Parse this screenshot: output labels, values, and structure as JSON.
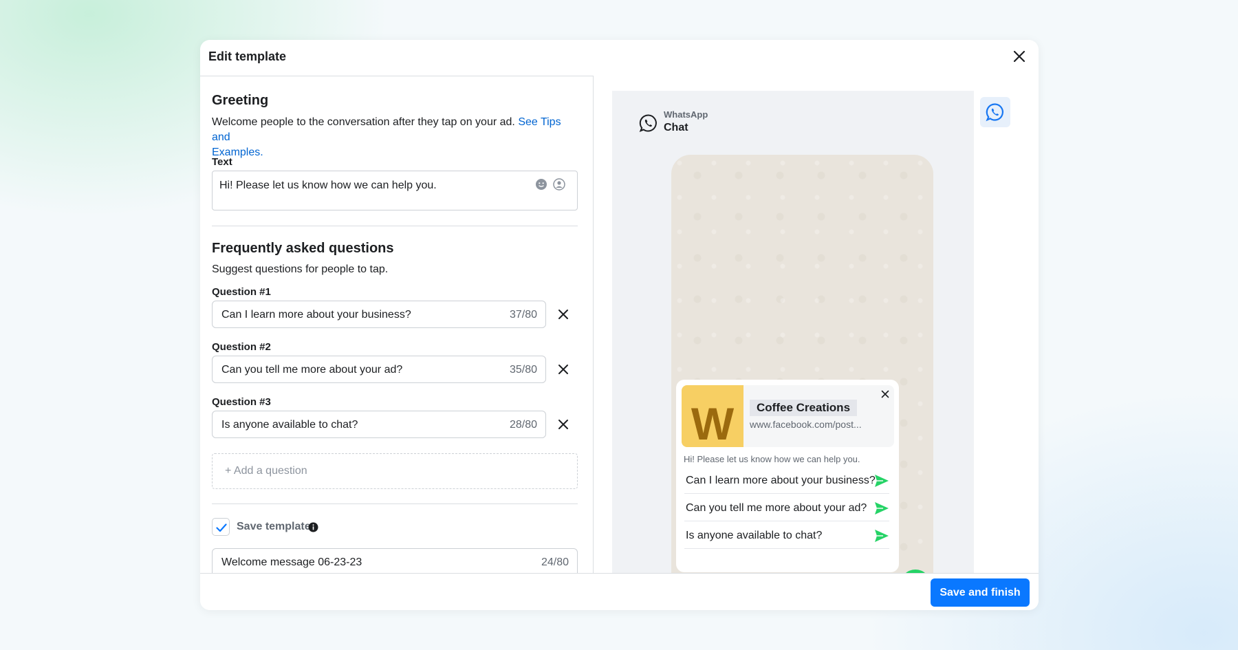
{
  "modal": {
    "title": "Edit template"
  },
  "greeting": {
    "title": "Greeting",
    "description": "Welcome people to the conversation after they tap on your ad.",
    "link_line1": "See Tips and",
    "link_line2": "Examples.",
    "text_label": "Text",
    "text_value": "Hi! Please let us know how we can help you."
  },
  "faq": {
    "title": "Frequently asked questions",
    "description": "Suggest questions for people to tap.",
    "questions": [
      {
        "label": "Question #1",
        "value": "Can I learn more about your business?",
        "count": "37/80"
      },
      {
        "label": "Question #2",
        "value": "Can you tell me more about your ad?",
        "count": "35/80"
      },
      {
        "label": "Question #3",
        "value": "Is anyone available to chat?",
        "count": "28/80"
      }
    ],
    "add_label": "+ Add a question"
  },
  "save_template": {
    "checked": true,
    "label": "Save template",
    "name_value": "Welcome message 06-23-23",
    "name_count": "24/80"
  },
  "preview": {
    "brand": "WhatsApp",
    "title": "Chat",
    "card": {
      "thumb_letter": "W",
      "business_name": "Coffee Creations",
      "url": "www.facebook.com/post...",
      "greeting": "Hi! Please let us know how we can help you.",
      "questions": [
        "Can I learn more about your business?",
        "Can you tell me more about your ad?",
        "Is anyone available to chat?"
      ]
    }
  },
  "footer": {
    "save_button": "Save and finish"
  },
  "colors": {
    "primary": "#0a78ff",
    "link": "#0064d1",
    "whatsapp_green": "#25d366",
    "thumb": "#f7cf63"
  },
  "icons": [
    "close-icon",
    "emoji-icon",
    "personalize-icon",
    "remove-icon",
    "check-icon",
    "info-icon",
    "whatsapp-icon",
    "send-icon"
  ]
}
